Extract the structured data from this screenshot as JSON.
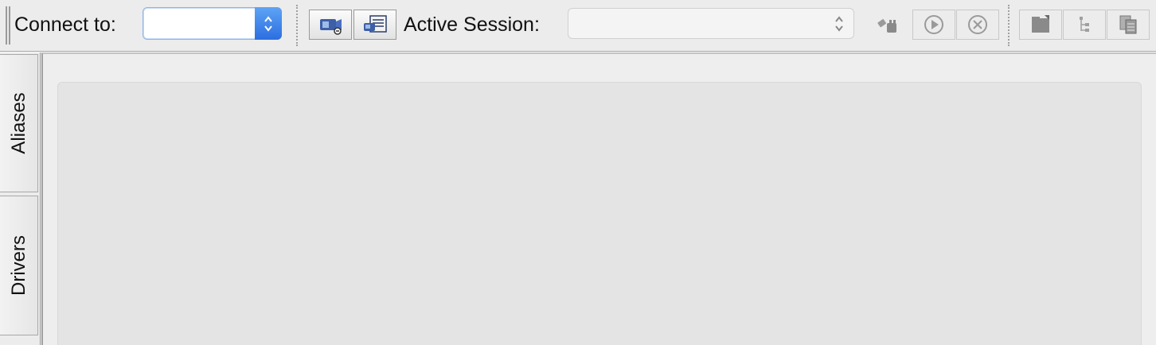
{
  "toolbar": {
    "connect_label": "Connect to:",
    "connect_value": "",
    "active_session_label": "Active Session:",
    "active_session_value": "",
    "buttons": [
      {
        "name": "connect-alias-button",
        "icon": "plug-icon",
        "enabled": true
      },
      {
        "name": "new-session-button",
        "icon": "session-window-icon",
        "enabled": true
      },
      {
        "name": "disconnect-button",
        "icon": "disconnect-icon",
        "enabled": false
      },
      {
        "name": "run-button",
        "icon": "play-icon",
        "enabled": false
      },
      {
        "name": "stop-button",
        "icon": "stop-icon",
        "enabled": false
      },
      {
        "name": "new-sql-worksheet-button",
        "icon": "folder-icon",
        "enabled": false
      },
      {
        "name": "object-tree-button",
        "icon": "tree-icon",
        "enabled": false
      },
      {
        "name": "copy-button",
        "icon": "copy-icon",
        "enabled": false
      }
    ]
  },
  "side_tabs": [
    {
      "label": "Aliases"
    },
    {
      "label": "Drivers"
    }
  ],
  "colors": {
    "combo_focus_blue": "#2b6ee0",
    "toolbar_bg": "#ececec",
    "content_bg": "#e4e4e4"
  }
}
